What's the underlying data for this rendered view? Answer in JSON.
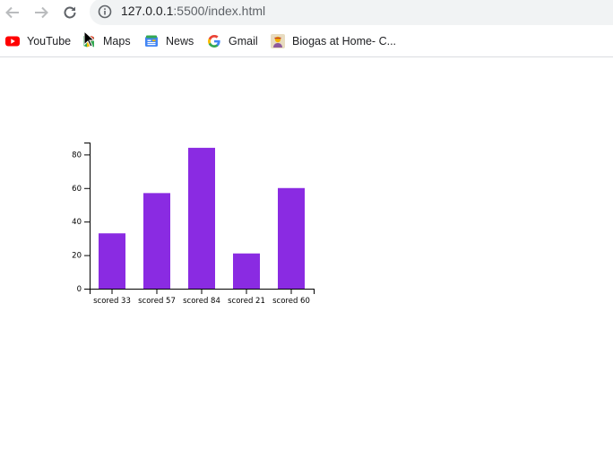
{
  "browser": {
    "url_host": "127.0.0.1",
    "url_rest": ":5500/index.html"
  },
  "bookmarks": [
    {
      "label": "YouTube",
      "icon": "youtube-icon"
    },
    {
      "label": "Maps",
      "icon": "maps-icon"
    },
    {
      "label": "News",
      "icon": "news-icon"
    },
    {
      "label": "Gmail",
      "icon": "google-icon"
    },
    {
      "label": "Biogas at Home- C...",
      "icon": "biogas-icon"
    }
  ],
  "chart_data": {
    "type": "bar",
    "categories": [
      "scored 33",
      "scored 57",
      "scored 84",
      "scored 21",
      "scored 60"
    ],
    "values": [
      33,
      57,
      84,
      21,
      60
    ],
    "ylim": [
      0,
      85
    ],
    "yticks": [
      0,
      20,
      40,
      60,
      80
    ],
    "bar_color": "#8a2be2",
    "grid": false
  }
}
